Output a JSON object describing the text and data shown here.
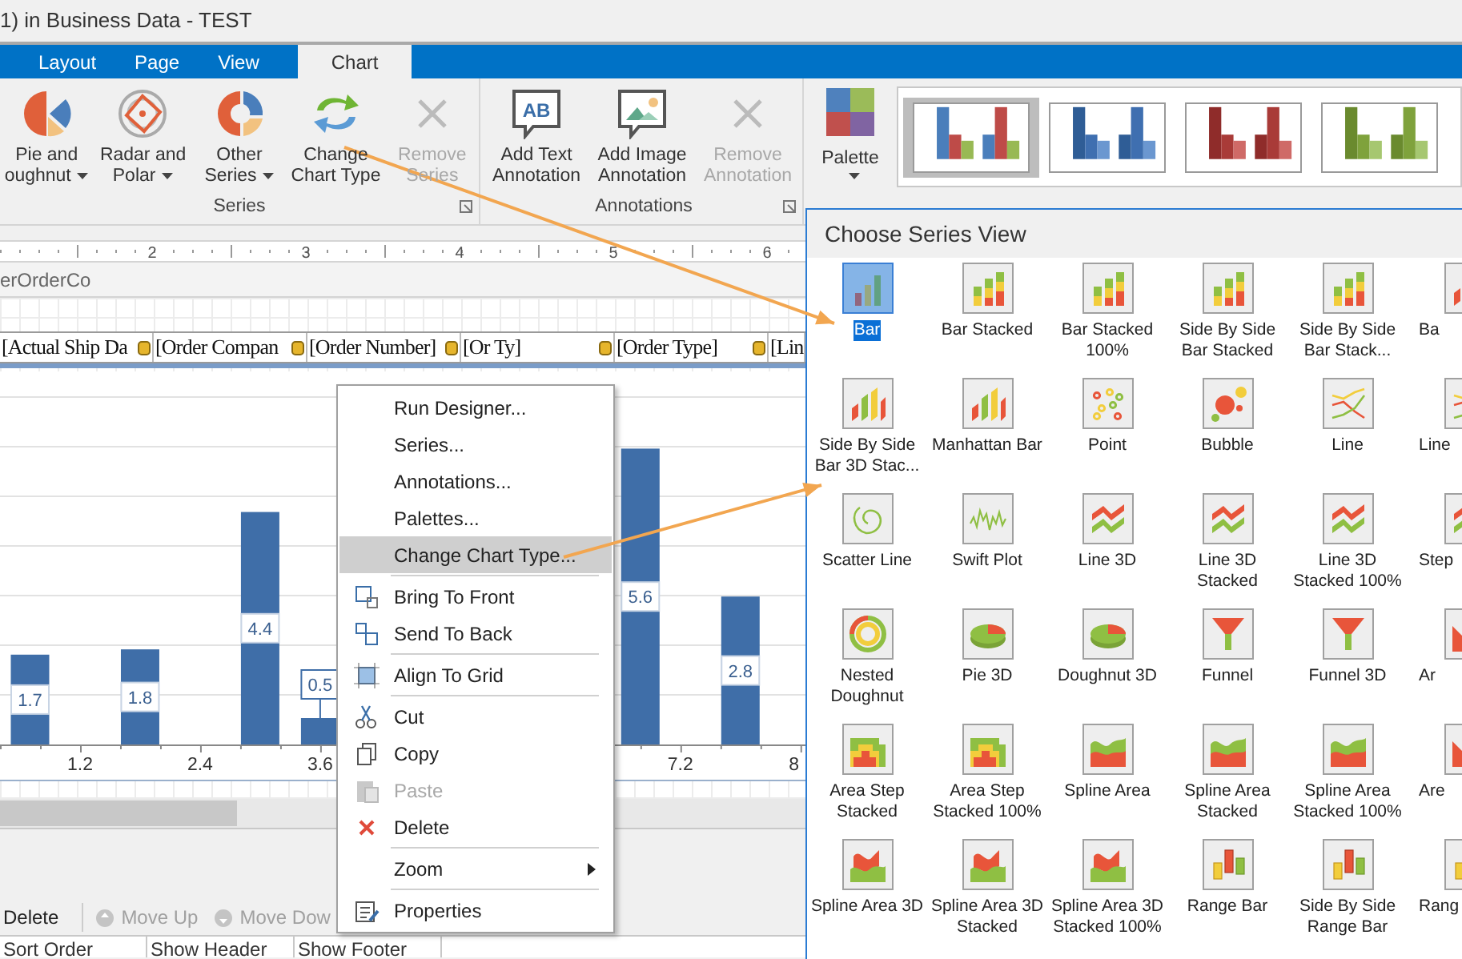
{
  "window": {
    "title": "1) in Business Data - TEST"
  },
  "tabs": [
    {
      "label": "Layout",
      "selected": false
    },
    {
      "label": "Page",
      "selected": false
    },
    {
      "label": "View",
      "selected": false
    },
    {
      "label": "Chart",
      "selected": true
    }
  ],
  "ribbon": {
    "groups": [
      {
        "label": "Series",
        "buttons": [
          {
            "kind": "pie",
            "lines": [
              "Pie and",
              "oughnut"
            ],
            "dropdown": true,
            "disabled": false
          },
          {
            "kind": "radar",
            "lines": [
              "Radar and",
              "Polar"
            ],
            "dropdown": true,
            "disabled": false
          },
          {
            "kind": "other",
            "lines": [
              "Other",
              "Series"
            ],
            "dropdown": true,
            "disabled": false
          },
          {
            "kind": "change",
            "lines": [
              "Change",
              "Chart Type"
            ],
            "dropdown": false,
            "disabled": false
          },
          {
            "kind": "remove",
            "lines": [
              "Remove",
              "Series"
            ],
            "dropdown": false,
            "disabled": true
          }
        ]
      },
      {
        "label": "Annotations",
        "buttons": [
          {
            "kind": "text",
            "lines": [
              "Add Text",
              "Annotation"
            ],
            "dropdown": false,
            "disabled": false,
            "icon_text": "AB"
          },
          {
            "kind": "image",
            "lines": [
              "Add Image",
              "Annotation"
            ],
            "dropdown": false,
            "disabled": false
          },
          {
            "kind": "remove",
            "lines": [
              "Remove",
              "Annotation"
            ],
            "dropdown": false,
            "disabled": true
          }
        ]
      }
    ],
    "palette_button": {
      "label": "Palette",
      "dropdown": true
    },
    "palettes": [
      {
        "selected": true,
        "kind": "mixed"
      },
      {
        "selected": false,
        "kind": "blue"
      },
      {
        "selected": false,
        "kind": "red"
      },
      {
        "selected": false,
        "kind": "green"
      }
    ]
  },
  "ruler": {
    "marks": [
      "2",
      "3",
      "4",
      "5",
      "6"
    ]
  },
  "band": {
    "label": "erOrderCo"
  },
  "fields": [
    "[Actual Ship Da",
    "[Order Compan",
    "[Order Number]",
    "[Or Ty]",
    "[Order Type]",
    "[Lin"
  ],
  "chart": {
    "chart_data": {
      "type": "bar",
      "x": [
        0.7,
        1.8,
        3.0,
        3.6,
        6.8,
        7.8
      ],
      "values": [
        1.7,
        1.8,
        4.4,
        0.5,
        5.6,
        2.8
      ],
      "xlim": [
        0.4,
        8.45
      ],
      "xticks": [
        {
          "value": 1.2,
          "label": "1.2"
        },
        {
          "value": 2.4,
          "label": "2.4"
        },
        {
          "value": 3.6,
          "label": "3.6"
        },
        {
          "value": 7.2,
          "label": "7.2"
        },
        {
          "value": 8.4,
          "label": "8"
        }
      ],
      "data_labels": true
    }
  },
  "toolbar": [
    {
      "label": "Delete",
      "disabled": false
    },
    {
      "label": "Move Up",
      "disabled": true
    },
    {
      "label": "Move Dow",
      "disabled": true
    }
  ],
  "columns": [
    "Sort Order",
    "Show Header",
    "Show Footer"
  ],
  "context_menu": [
    {
      "kind": "plain",
      "label": "Run Designer...",
      "selected": false,
      "disabled": false
    },
    {
      "kind": "plain",
      "label": "Series...",
      "selected": false,
      "disabled": false
    },
    {
      "kind": "plain",
      "label": "Annotations...",
      "selected": false,
      "disabled": false
    },
    {
      "kind": "plain",
      "label": "Palettes...",
      "selected": false,
      "disabled": false
    },
    {
      "kind": "plain",
      "label": "Change Chart Type...",
      "selected": true,
      "disabled": false
    },
    {
      "kind": "separator"
    },
    {
      "kind": "front",
      "label": "Bring To Front",
      "selected": false,
      "disabled": false
    },
    {
      "kind": "back",
      "label": "Send To Back",
      "selected": false,
      "disabled": false
    },
    {
      "kind": "separator"
    },
    {
      "kind": "align",
      "label": "Align To Grid",
      "selected": false,
      "disabled": false
    },
    {
      "kind": "separator"
    },
    {
      "kind": "cut",
      "label": "Cut",
      "selected": false,
      "disabled": false
    },
    {
      "kind": "copy",
      "label": "Copy",
      "selected": false,
      "disabled": false
    },
    {
      "kind": "paste",
      "label": "Paste",
      "selected": false,
      "disabled": true
    },
    {
      "kind": "delete",
      "label": "Delete",
      "selected": false,
      "disabled": false
    },
    {
      "kind": "separator"
    },
    {
      "kind": "submenu",
      "label": "Zoom",
      "selected": false,
      "disabled": false
    },
    {
      "kind": "separator"
    },
    {
      "kind": "properties",
      "label": "Properties",
      "selected": false,
      "disabled": false
    }
  ],
  "series_view": {
    "title": "Choose Series View",
    "items": [
      {
        "kind": "bar",
        "label": "Bar",
        "selected": true
      },
      {
        "kind": "stacked",
        "label": "Bar Stacked",
        "selected": false
      },
      {
        "kind": "stacked",
        "label": "Bar Stacked 100%",
        "selected": false
      },
      {
        "kind": "stacked",
        "label": "Side By Side Bar Stacked",
        "selected": false
      },
      {
        "kind": "stacked",
        "label": "Side By Side Bar Stack...",
        "selected": false
      },
      {
        "kind": "bar3d",
        "label": "Ba",
        "selected": false
      },
      {
        "kind": "bar3d",
        "label": "Side By Side Bar 3D Stac...",
        "selected": false
      },
      {
        "kind": "bar3d",
        "label": "Manhattan Bar",
        "selected": false
      },
      {
        "kind": "point",
        "label": "Point",
        "selected": false
      },
      {
        "kind": "bubble",
        "label": "Bubble",
        "selected": false
      },
      {
        "kind": "line",
        "label": "Line",
        "selected": false
      },
      {
        "kind": "line",
        "label": "Line",
        "selected": false
      },
      {
        "kind": "scatter",
        "label": "Scatter Line",
        "selected": false
      },
      {
        "kind": "swift",
        "label": "Swift Plot",
        "selected": false
      },
      {
        "kind": "line3d",
        "label": "Line 3D",
        "selected": false
      },
      {
        "kind": "line3d",
        "label": "Line 3D Stacked",
        "selected": false
      },
      {
        "kind": "line3d",
        "label": "Line 3D Stacked 100%",
        "selected": false
      },
      {
        "kind": "line3d",
        "label": "Step",
        "selected": false
      },
      {
        "kind": "doughnut",
        "label": "Nested Doughnut",
        "selected": false
      },
      {
        "kind": "pie3d",
        "label": "Pie 3D",
        "selected": false
      },
      {
        "kind": "pie3d",
        "label": "Doughnut 3D",
        "selected": false
      },
      {
        "kind": "funnel",
        "label": "Funnel",
        "selected": false
      },
      {
        "kind": "funnel",
        "label": "Funnel 3D",
        "selected": false
      },
      {
        "kind": "area",
        "label": "Ar",
        "selected": false
      },
      {
        "kind": "areastep",
        "label": "Area Step Stacked",
        "selected": false
      },
      {
        "kind": "areastep",
        "label": "Area Step Stacked 100%",
        "selected": false
      },
      {
        "kind": "spline",
        "label": "Spline Area",
        "selected": false
      },
      {
        "kind": "spline",
        "label": "Spline Area Stacked",
        "selected": false
      },
      {
        "kind": "spline",
        "label": "Spline Area Stacked 100%",
        "selected": false
      },
      {
        "kind": "area",
        "label": "Are",
        "selected": false
      },
      {
        "kind": "spline3d",
        "label": "Spline Area 3D",
        "selected": false
      },
      {
        "kind": "spline3d",
        "label": "Spline Area 3D Stacked",
        "selected": false
      },
      {
        "kind": "spline3d",
        "label": "Spline Area 3D Stacked 100%",
        "selected": false
      },
      {
        "kind": "range",
        "label": "Range Bar",
        "selected": false
      },
      {
        "kind": "range",
        "label": "Side By Side Range Bar",
        "selected": false
      },
      {
        "kind": "range",
        "label": "Rang",
        "selected": false
      }
    ]
  }
}
